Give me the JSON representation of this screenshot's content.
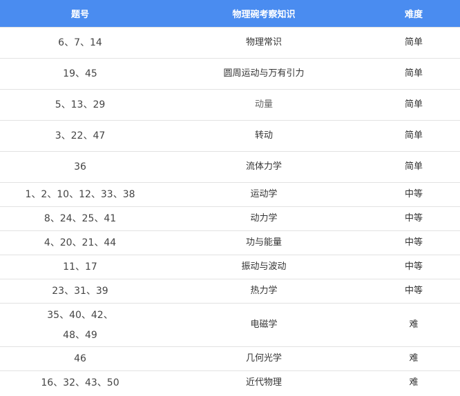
{
  "headers": {
    "questions": "题号",
    "topic": "物理碗考察知识",
    "difficulty": "难度"
  },
  "rows": [
    {
      "questions": [
        "6、7、14"
      ],
      "topic": "物理常识",
      "difficulty": "简单"
    },
    {
      "questions": [
        "19、45"
      ],
      "topic": "圆周运动与万有引力",
      "difficulty": "简单"
    },
    {
      "questions": [
        "5、13、29"
      ],
      "topic": "动量",
      "difficulty": "简单"
    },
    {
      "questions": [
        "3、22、47"
      ],
      "topic": "转动",
      "difficulty": "简单"
    },
    {
      "questions": [
        "36"
      ],
      "topic": "流体力学",
      "difficulty": "简单"
    },
    {
      "questions": [
        "1、2、10、12、33、38"
      ],
      "topic": "运动学",
      "difficulty": "中等"
    },
    {
      "questions": [
        "8、24、25、41"
      ],
      "topic": "动力学",
      "difficulty": "中等"
    },
    {
      "questions": [
        "4、20、21、44"
      ],
      "topic": "功与能量",
      "difficulty": "中等"
    },
    {
      "questions": [
        "11、17"
      ],
      "topic": "振动与波动",
      "difficulty": "中等"
    },
    {
      "questions": [
        "23、31、39"
      ],
      "topic": "热力学",
      "difficulty": "中等"
    },
    {
      "questions": [
        "35、40、42、",
        "48、49"
      ],
      "topic": "电磁学",
      "difficulty": "难"
    },
    {
      "questions": [
        "46"
      ],
      "topic": "几何光学",
      "difficulty": "难"
    },
    {
      "questions": [
        "16、32、43、50"
      ],
      "topic": "近代物理",
      "difficulty": "难"
    }
  ]
}
